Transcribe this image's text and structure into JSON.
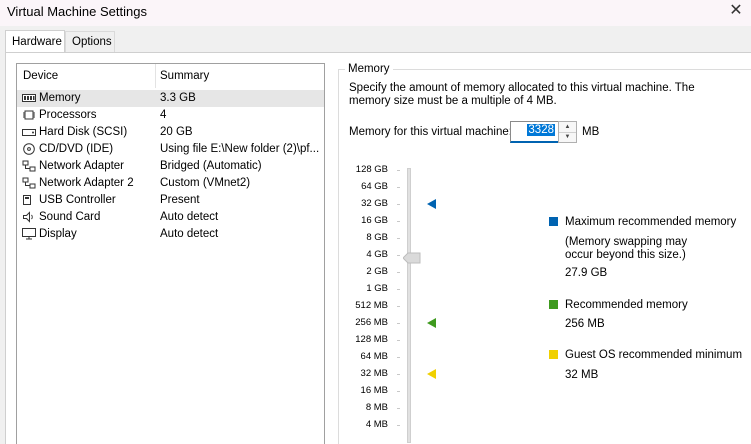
{
  "window": {
    "title": "Virtual Machine Settings"
  },
  "tabs": [
    {
      "label": "Hardware"
    },
    {
      "label": "Options"
    }
  ],
  "device_list": {
    "headers": {
      "device": "Device",
      "summary": "Summary"
    },
    "rows": [
      {
        "device": "Memory",
        "summary": "3.3 GB",
        "icon": "memory-icon"
      },
      {
        "device": "Processors",
        "summary": "4",
        "icon": "processor-icon"
      },
      {
        "device": "Hard Disk (SCSI)",
        "summary": "20 GB",
        "icon": "hard-disk-icon"
      },
      {
        "device": "CD/DVD (IDE)",
        "summary": "Using file E:\\New folder (2)\\pf...",
        "icon": "cd-dvd-icon"
      },
      {
        "device": "Network Adapter",
        "summary": "Bridged (Automatic)",
        "icon": "network-adapter-icon"
      },
      {
        "device": "Network Adapter 2",
        "summary": "Custom (VMnet2)",
        "icon": "network-adapter-icon"
      },
      {
        "device": "USB Controller",
        "summary": "Present",
        "icon": "usb-icon"
      },
      {
        "device": "Sound Card",
        "summary": "Auto detect",
        "icon": "speaker-icon"
      },
      {
        "device": "Display",
        "summary": "Auto detect",
        "icon": "monitor-icon"
      }
    ]
  },
  "memory": {
    "group_label": "Memory",
    "description": "Specify the amount of memory allocated to this virtual machine. The memory size must be a multiple of 4 MB.",
    "field_label": "Memory for this virtual machine:",
    "value": "3328",
    "unit": "MB",
    "scale_labels": [
      "128 GB",
      "64 GB",
      "32 GB",
      "16 GB",
      "8 GB",
      "4 GB",
      "2 GB",
      "1 GB",
      "512 MB",
      "256 MB",
      "128 MB",
      "64 MB",
      "32 MB",
      "16 MB",
      "8 MB",
      "4 MB"
    ],
    "legend": {
      "max": {
        "label": "Maximum recommended memory",
        "note_line1": "(Memory swapping may",
        "note_line2": "occur beyond this size.)",
        "value": "27.9 GB",
        "color": "#0063b1"
      },
      "rec": {
        "label": "Recommended memory",
        "value": "256 MB",
        "color": "#3e9a1e"
      },
      "guest": {
        "label": "Guest OS recommended minimum",
        "value": "32 MB",
        "color": "#f0d000"
      }
    }
  }
}
